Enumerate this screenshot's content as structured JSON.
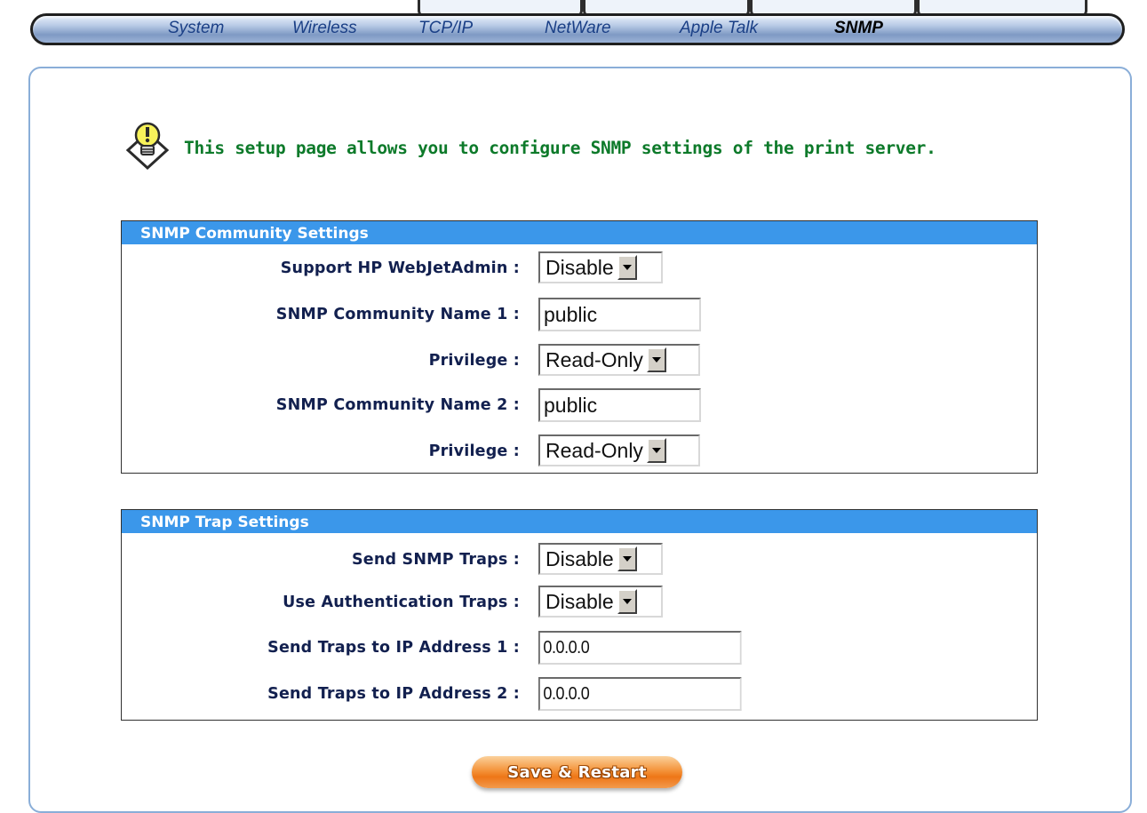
{
  "nav": {
    "tabs": [
      {
        "label": "System"
      },
      {
        "label": "Wireless"
      },
      {
        "label": "TCP/IP"
      },
      {
        "label": "NetWare"
      },
      {
        "label": "Apple Talk"
      },
      {
        "label": "SNMP",
        "active": true
      }
    ]
  },
  "intro": {
    "icon": "lightbulb-icon",
    "text": "This setup page allows you to configure SNMP settings of the print server."
  },
  "community": {
    "title": "SNMP Community Settings",
    "webjetadmin_label": "Support HP WebJetAdmin :",
    "webjetadmin_value": "Disable",
    "name1_label": "SNMP Community Name 1 :",
    "name1_value": "public",
    "privilege1_label": "Privilege :",
    "privilege1_value": "Read-Only",
    "name2_label": "SNMP Community Name 2 :",
    "name2_value": "public",
    "privilege2_label": "Privilege :",
    "privilege2_value": "Read-Only"
  },
  "trap": {
    "title": "SNMP Trap Settings",
    "send_label": "Send SNMP Traps :",
    "send_value": "Disable",
    "auth_label": "Use Authentication Traps :",
    "auth_value": "Disable",
    "ip1_label": "Send Traps to IP Address 1 :",
    "ip1_value": "0.0.0.0",
    "ip2_label": "Send Traps to IP Address 2 :",
    "ip2_value": "0.0.0.0"
  },
  "actions": {
    "save_label": "Save & Restart"
  },
  "colors": {
    "section_header": "#3b97ea",
    "intro_text": "#0d7a2a",
    "label_text": "#12204f",
    "save_button": "#ee7617"
  }
}
